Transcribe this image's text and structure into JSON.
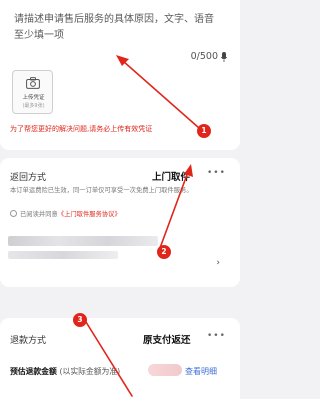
{
  "description": {
    "placeholder": "请描述申请售后服务的具体原因，文字、语音至少填一项",
    "counter": "0/500",
    "upload_label": "上传凭证",
    "upload_sub": "(最多9张)",
    "warning": "为了帮您更好的解决问题,请务必上传有效凭证"
  },
  "return_method": {
    "title": "返回方式",
    "value": "上门取件",
    "more": "•••",
    "note": "本订单运费险已生效，同一订单仅可享受一次免费上门取件服务。",
    "agree_prefix": "已阅读并同意",
    "agree_link": "《上门取件服务协议》",
    "chevron": "›"
  },
  "refund": {
    "title": "退款方式",
    "value": "原支付返还",
    "more": "•••",
    "amount_label": "预估退款金额",
    "amount_sub": "(以实际金额为准)",
    "view_detail": "查看明细"
  },
  "annotations": [
    "1",
    "2",
    "3"
  ],
  "colors": {
    "accent_red": "#e1251b",
    "link_blue": "#3f6fd8",
    "background": "#f2f2f4"
  }
}
